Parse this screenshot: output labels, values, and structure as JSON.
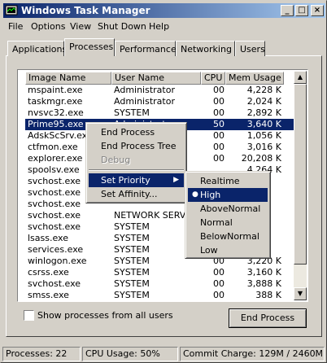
{
  "window": {
    "title": "Windows Task Manager"
  },
  "menubar": [
    "File",
    "Options",
    "View",
    "Shut Down",
    "Help"
  ],
  "tabs": [
    "Applications",
    "Processes",
    "Performance",
    "Networking",
    "Users"
  ],
  "columns": {
    "name": "Image Name",
    "user": "User Name",
    "cpu": "CPU",
    "mem": "Mem Usage"
  },
  "processes": [
    {
      "name": "mspaint.exe",
      "user": "Administrator",
      "cpu": "00",
      "mem": "4,228 K"
    },
    {
      "name": "taskmgr.exe",
      "user": "Administrator",
      "cpu": "00",
      "mem": "2,024 K"
    },
    {
      "name": "nvsvc32.exe",
      "user": "SYSTEM",
      "cpu": "00",
      "mem": "2,892 K"
    },
    {
      "name": "Prime95.exe",
      "user": "Administrator",
      "cpu": "50",
      "mem": "3,640 K"
    },
    {
      "name": "AdskScSrv.exe",
      "user": "",
      "cpu": "00",
      "mem": "1,056 K"
    },
    {
      "name": "ctfmon.exe",
      "user": "",
      "cpu": "00",
      "mem": "3,016 K"
    },
    {
      "name": "explorer.exe",
      "user": "",
      "cpu": "00",
      "mem": "20,208 K"
    },
    {
      "name": "spoolsv.exe",
      "user": "",
      "cpu": "",
      "mem": "4,264 K"
    },
    {
      "name": "svchost.exe",
      "user": "",
      "cpu": "",
      "mem": ""
    },
    {
      "name": "svchost.exe",
      "user": "",
      "cpu": "",
      "mem": ""
    },
    {
      "name": "svchost.exe",
      "user": "",
      "cpu": "",
      "mem": ""
    },
    {
      "name": "svchost.exe",
      "user": "NETWORK SERVIC",
      "cpu": "",
      "mem": ""
    },
    {
      "name": "svchost.exe",
      "user": "SYSTEM",
      "cpu": "",
      "mem": ""
    },
    {
      "name": "lsass.exe",
      "user": "SYSTEM",
      "cpu": "",
      "mem": ""
    },
    {
      "name": "services.exe",
      "user": "SYSTEM",
      "cpu": "",
      "mem": ""
    },
    {
      "name": "winlogon.exe",
      "user": "SYSTEM",
      "cpu": "00",
      "mem": "3,220 K"
    },
    {
      "name": "csrss.exe",
      "user": "SYSTEM",
      "cpu": "00",
      "mem": "3,160 K"
    },
    {
      "name": "svchost.exe",
      "user": "SYSTEM",
      "cpu": "00",
      "mem": "3,888 K"
    },
    {
      "name": "smss.exe",
      "user": "SYSTEM",
      "cpu": "00",
      "mem": "388 K"
    }
  ],
  "selected_process": "Prime95.exe",
  "context_menu": [
    "End Process",
    "End Process Tree",
    "Debug",
    "Set Priority",
    "Set Affinity..."
  ],
  "priority_menu": [
    "Realtime",
    "High",
    "AboveNormal",
    "Normal",
    "BelowNormal",
    "Low"
  ],
  "checked_priority": "High",
  "show_all_processes": "Show processes from all users",
  "end_process_button": "End Process",
  "status": {
    "processes": "Processes: 22",
    "cpu": "CPU Usage: 50%",
    "commit": "Commit Charge: 129M / 2460M"
  },
  "colors": {
    "title_gradient_start": "#0a246a",
    "title_gradient_end": "#a6caf0",
    "selection": "#0a246a",
    "face": "#d4d0c8"
  },
  "icons": [
    "task-manager-icon",
    "minimize-icon",
    "maximize-icon",
    "close-icon",
    "scroll-up-icon",
    "scroll-down-icon",
    "submenu-arrow-icon",
    "radio-bullet-icon"
  ]
}
